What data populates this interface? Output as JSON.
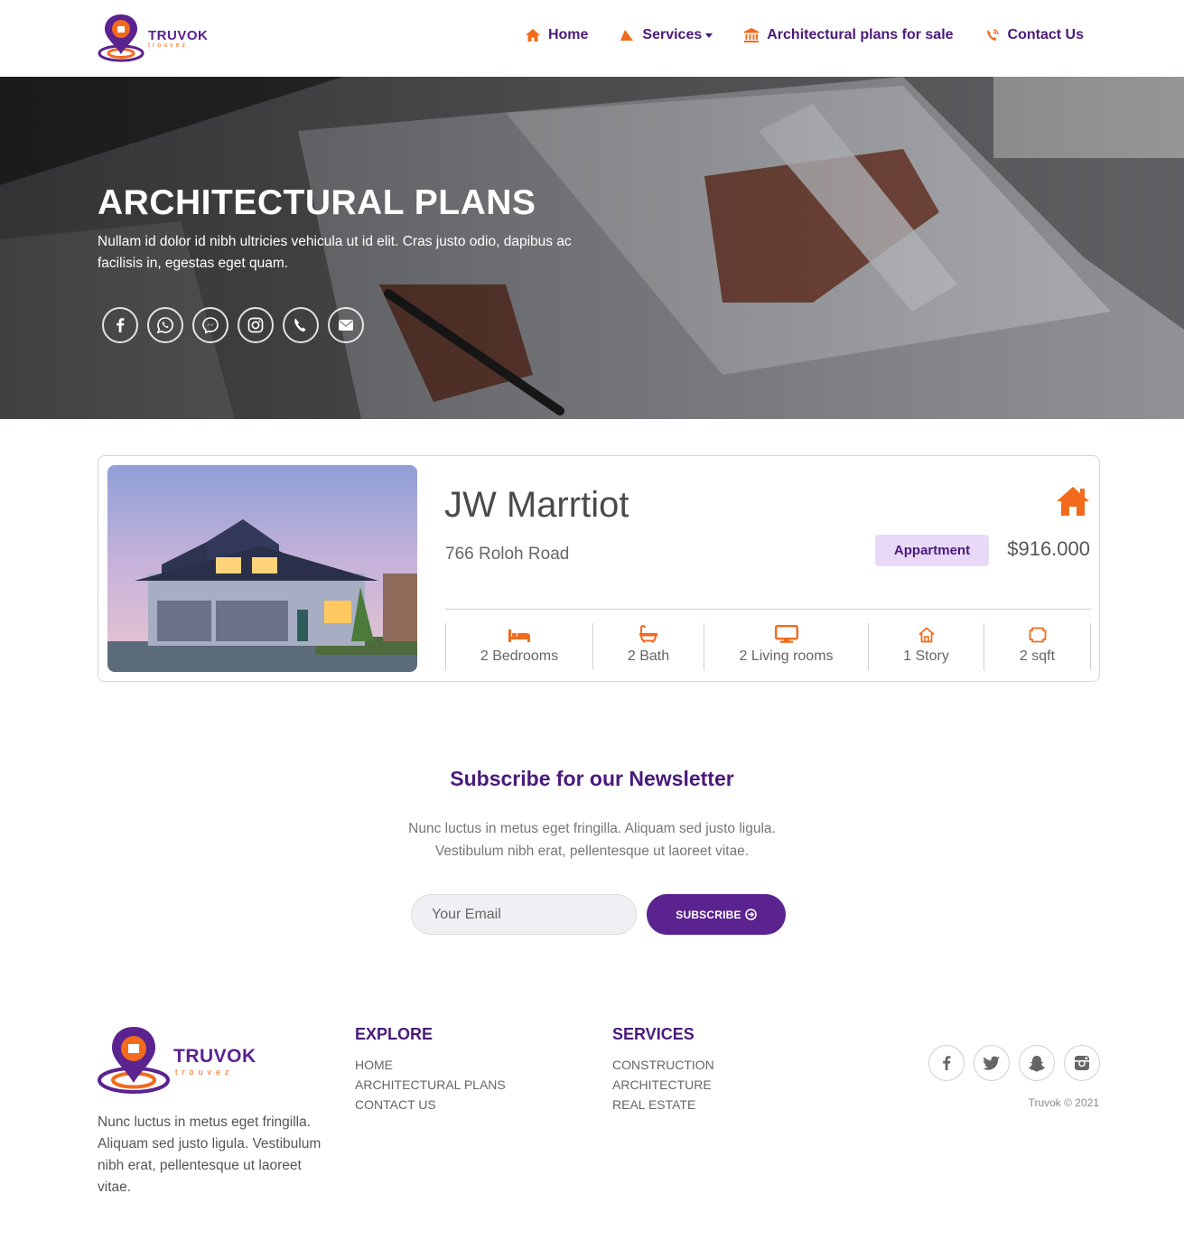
{
  "nav": {
    "logo_name": "TRUVOK",
    "logo_sub": "trouvez",
    "links": [
      {
        "label": "Home",
        "icon": "home-icon"
      },
      {
        "label": "Services",
        "icon": "services-icon"
      },
      {
        "label": "Architectural plans for sale",
        "icon": "bank-icon"
      },
      {
        "label": "Contact Us",
        "icon": "phone-ring-icon"
      }
    ]
  },
  "hero": {
    "title": "ARCHITECTURAL PLANS",
    "text": "Nullam id dolor id nibh ultricies vehicula ut id elit. Cras justo odio, dapibus ac facilisis in, egestas eget quam.",
    "social": [
      "facebook-icon",
      "whatsapp-icon",
      "messenger-icon",
      "instagram-icon",
      "phone-icon",
      "mail-icon"
    ]
  },
  "listing": {
    "title": "JW Marrtiot",
    "address": "766 Roloh Road",
    "badge": "Appartment",
    "price": "$916.000",
    "features": [
      {
        "label": "2 Bedrooms",
        "icon": "bed-icon"
      },
      {
        "label": "2 Bath",
        "icon": "bath-icon"
      },
      {
        "label": "2 Living rooms",
        "icon": "monitor-icon"
      },
      {
        "label": "1 Story",
        "icon": "house-outline-icon"
      },
      {
        "label": "2 sqft",
        "icon": "area-icon"
      }
    ]
  },
  "newsletter": {
    "title": "Subscribe for our Newsletter",
    "text_line1": "Nunc luctus in metus eget fringilla. Aliquam sed justo ligula.",
    "text_line2": "Vestibulum nibh erat, pellentesque ut laoreet vitae.",
    "email_placeholder": "Your Email",
    "button": "SUBSCRIBE"
  },
  "footer": {
    "about": "Nunc luctus in metus eget fringilla. Aliquam sed justo ligula. Vestibulum nibh erat, pellentesque ut laoreet vitae.",
    "explore_title": "EXPLORE",
    "explore_links": [
      "HOME",
      "ARCHITECTURAL PLANS",
      "CONTACT US"
    ],
    "services_title": "SERVICES",
    "services_links": [
      "CONSTRUCTION",
      "ARCHITECTURE",
      "REAL ESTATE"
    ],
    "social": [
      "facebook-icon",
      "twitter-icon",
      "snapchat-icon",
      "instagram-icon"
    ],
    "copyright": "Truvok © 2021"
  },
  "colors": {
    "brand_purple": "#4a1a7a",
    "button_purple": "#5b2390",
    "accent_orange": "#f26b1d",
    "badge_bg": "#e9d9f8"
  }
}
